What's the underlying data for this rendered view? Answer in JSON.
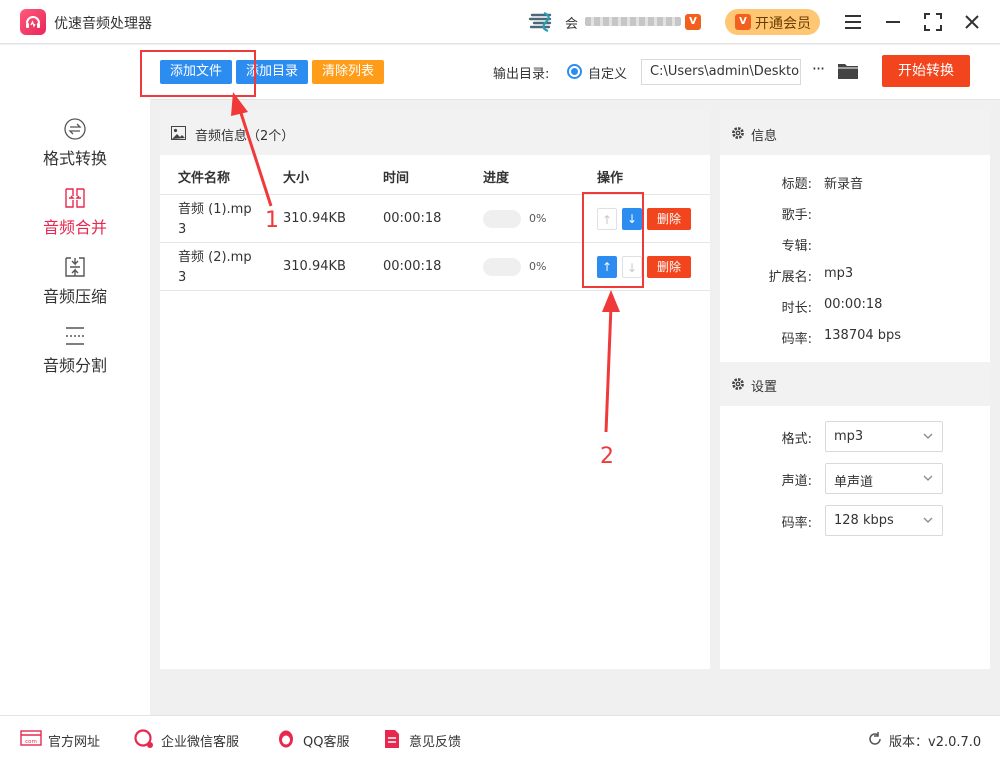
{
  "app": {
    "title": "优速音频处理器",
    "user_name": "会",
    "vip_button": "开通会员",
    "vip_badge": "V"
  },
  "sidebar": {
    "items": [
      {
        "label": "格式转换",
        "icon": "swap-circle-icon"
      },
      {
        "label": "音频合并",
        "icon": "merge-icon",
        "active": true
      },
      {
        "label": "音频压缩",
        "icon": "compress-icon"
      },
      {
        "label": "音频分割",
        "icon": "split-icon"
      }
    ]
  },
  "toolbar": {
    "add_file": "添加文件",
    "add_dir": "添加目录",
    "clear_list": "清除列表",
    "output_label": "输出目录:",
    "custom_label": "自定义",
    "output_path": "C:\\Users\\admin\\Desktop",
    "more": "···",
    "start": "开始转换"
  },
  "file_panel": {
    "title": "音频信息（2个）",
    "columns": [
      "文件名称",
      "大小",
      "时间",
      "进度",
      "操作"
    ],
    "rows": [
      {
        "name": "音频 (1).mp3",
        "size": "310.94KB",
        "time": "00:00:18",
        "progress": 0,
        "progress_text": "0%",
        "up_enabled": false,
        "down_enabled": true,
        "delete": "删除"
      },
      {
        "name": "音频 (2).mp3",
        "size": "310.94KB",
        "time": "00:00:18",
        "progress": 0,
        "progress_text": "0%",
        "up_enabled": true,
        "down_enabled": false,
        "delete": "删除"
      }
    ]
  },
  "info_panel": {
    "title": "信息",
    "fields": [
      {
        "key": "标题:",
        "value": "新录音"
      },
      {
        "key": "歌手:",
        "value": ""
      },
      {
        "key": "专辑:",
        "value": ""
      },
      {
        "key": "扩展名:",
        "value": "mp3"
      },
      {
        "key": "时长:",
        "value": "00:00:18"
      },
      {
        "key": "码率:",
        "value": "138704 bps"
      }
    ]
  },
  "settings_panel": {
    "title": "设置",
    "fields": [
      {
        "key": "格式:",
        "value": "mp3"
      },
      {
        "key": "声道:",
        "value": "单声道"
      },
      {
        "key": "码率:",
        "value": "128 kbps"
      }
    ]
  },
  "footer": {
    "items": [
      {
        "label": "官方网址",
        "icon": "website-icon"
      },
      {
        "label": "企业微信客服",
        "icon": "wechat-work-icon"
      },
      {
        "label": "QQ客服",
        "icon": "qq-icon"
      },
      {
        "label": "意见反馈",
        "icon": "feedback-icon"
      }
    ],
    "version": "版本：v2.0.7.0"
  },
  "annotations": {
    "label_1": "1",
    "label_2": "2"
  },
  "colors": {
    "primary": "#2d8cf0",
    "danger": "#f2441d",
    "warning": "#ff9d1b",
    "active_nav": "#e8294f",
    "annotation": "#f03a3a"
  }
}
